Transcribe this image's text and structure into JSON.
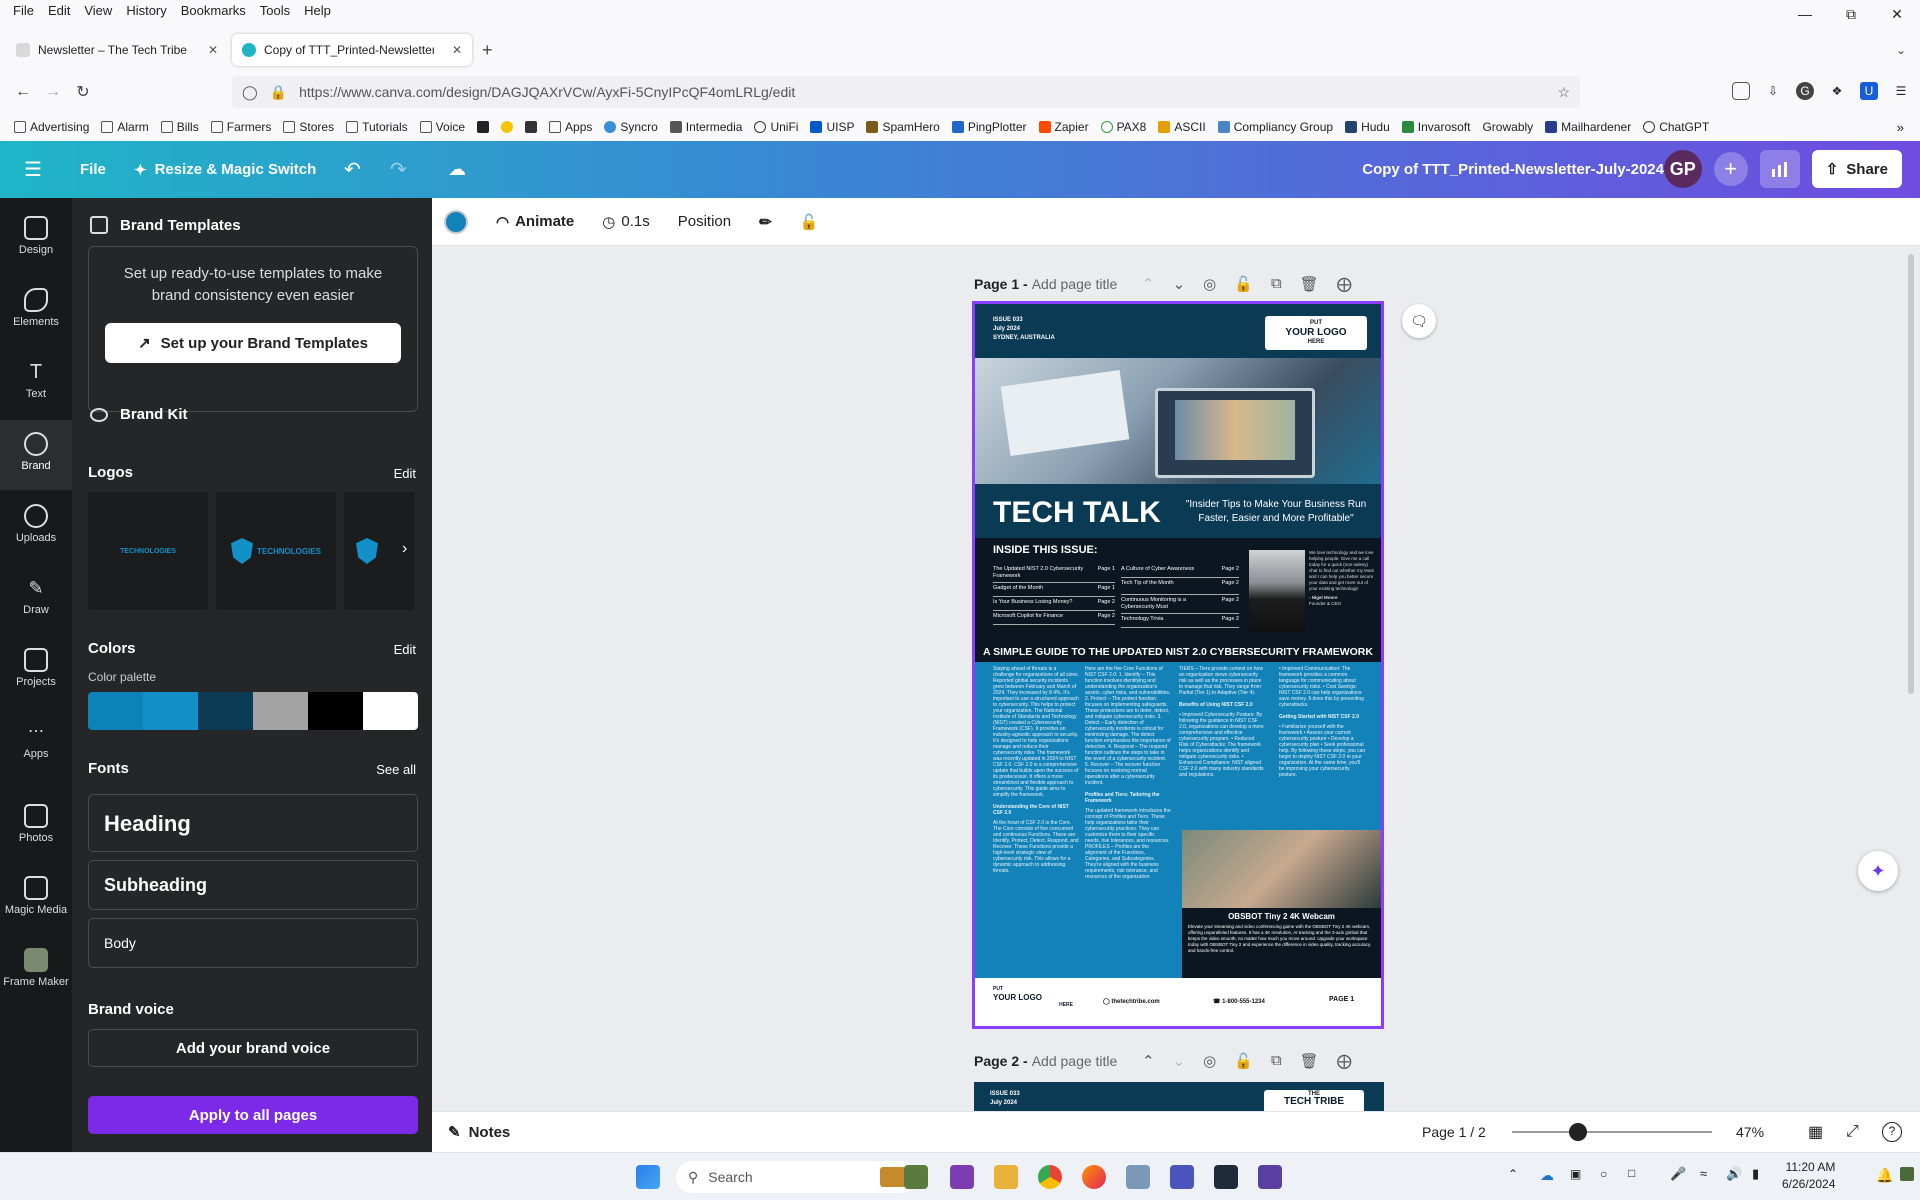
{
  "browser": {
    "menu": [
      "File",
      "Edit",
      "View",
      "History",
      "Bookmarks",
      "Tools",
      "Help"
    ],
    "tabs": [
      {
        "title": "Newsletter – The Tech Tribe",
        "active": false
      },
      {
        "title": "Copy of TTT_Printed-Newsletter-J",
        "active": true
      }
    ],
    "url": "https://www.canva.com/design/DAGJQAXrVCw/AyxFi-5CnyIPcQF4omLRLg/edit",
    "bookmarks": [
      "Advertising",
      "Alarm",
      "Bills",
      "Farmers",
      "Stores",
      "Tutorials",
      "Voice",
      "Apps",
      "Syncro",
      "Intermedia",
      "UniFi",
      "UISP",
      "SpamHero",
      "PingPlotter",
      "Zapier",
      "PAX8",
      "ASCII",
      "Compliancy Group",
      "Hudu",
      "Invarosoft",
      "Growably",
      "Mailhardener",
      "ChatGPT"
    ]
  },
  "canva": {
    "header": {
      "file_label": "File",
      "resize_label": "Resize & Magic Switch",
      "doc_title": "Copy of  TTT_Printed-Newsletter-July-2024",
      "avatar_initials": "GP",
      "share_label": "Share"
    },
    "rail": [
      {
        "label": "Design"
      },
      {
        "label": "Elements"
      },
      {
        "label": "Text"
      },
      {
        "label": "Brand"
      },
      {
        "label": "Uploads"
      },
      {
        "label": "Draw"
      },
      {
        "label": "Projects"
      },
      {
        "label": "Apps"
      },
      {
        "label": "Photos"
      },
      {
        "label": "Magic Media"
      },
      {
        "label": "Frame Maker"
      }
    ],
    "panel": {
      "brand_templates_title": "Brand Templates",
      "brand_templates_desc": "Set up ready-to-use templates to make brand consistency even easier",
      "brand_templates_button": "Set up your Brand Templates",
      "brand_kit_label": "Brand Kit",
      "logos_title": "Logos",
      "logos_edit": "Edit",
      "logo_texts": [
        "TECHNOLOGIES",
        "TECHNOLOGIES"
      ],
      "colors_title": "Colors",
      "colors_edit": "Edit",
      "palette_title": "Color palette",
      "palette": [
        "#0b83b8",
        "#1390c8",
        "#0b3a55",
        "#a3a3a3",
        "#000000",
        "#ffffff"
      ],
      "fonts_title": "Fonts",
      "fonts_see_all": "See all",
      "font_heading": "Heading",
      "font_subheading": "Subheading",
      "font_body": "Body",
      "voice_title": "Brand voice",
      "voice_button": "Add your brand voice",
      "apply_button": "Apply to all pages"
    },
    "toolbar": {
      "animate": "Animate",
      "duration": "0.1s",
      "position": "Position",
      "fill_color": "#1382b8"
    },
    "page1": {
      "label": "Page 1 -",
      "title_placeholder": "Add page title"
    },
    "page2": {
      "label": "Page 2 -",
      "title_placeholder": "Add page title"
    },
    "newsletter": {
      "issue": "ISSUE 033",
      "date": "July 2024",
      "location": "SYDNEY, AUSTRALIA",
      "logo_put": "PUT",
      "logo_your": "YOUR",
      "logo_logo": "LOGO",
      "logo_here": "HERE",
      "title": "TECH TALK",
      "tagline": "\"Insider Tips to Make Your Business Run Faster, Easier and More Profitable\"",
      "inside_title": "INSIDE THIS ISSUE:",
      "inside_left": [
        {
          "t": "The Updated NIST 2.0 Cybersecurity Framework",
          "p": "Page 1"
        },
        {
          "t": "Gadget of the Month",
          "p": "Page 1"
        },
        {
          "t": "Is Your Business Losing Money?",
          "p": "Page 2"
        },
        {
          "t": "Microsoft Copilot for Finance",
          "p": "Page 2"
        }
      ],
      "inside_right": [
        {
          "t": "A Culture of Cyber Awareness",
          "p": "Page 2"
        },
        {
          "t": "Tech Tip of the Month",
          "p": "Page 2"
        },
        {
          "t": "Continuous Monitoring is a Cybersecurity Must",
          "p": "Page 2"
        },
        {
          "t": "Technology Trivia",
          "p": "Page 2"
        }
      ],
      "bio": "We love technology and we love helping people. Give me a call today for a quick (non-salesy) chat to find out whether my team and I can help you better secure your data and get more out of your existing technology!",
      "bio_name": "- Nigel Moore",
      "bio_role": "Founder & CEO",
      "band": "A SIMPLE GUIDE TO THE UPDATED NIST 2.0 CYBERSECURITY FRAMEWORK",
      "col1": "Staying ahead of threats is a challenge for organizations of all sizes. Reported global security incidents grew between February and March of 2024. They increased by 8.4%. It's important to use a structured approach to cybersecurity. This helps to protect your organization. The National Institute of Standards and Technology (NIST) created a Cybersecurity Framework (CSF). It provides an industry-agnostic approach to security. It's designed to help organizations manage and reduce their cybersecurity risks. The framework was recently updated in 2024 to NIST CSF 2.0. CSF 2.0 is a comprehensive update that builds upon the success of its predecessor. It offers a more streamlined and flexible approach to cybersecurity. This guide aims to simplify the framework.",
      "col1_h": "Understanding the Core of NIST CSF 2.0",
      "col1b": "At the heart of CSF 2.0 is the Core. The Core consists of five concurrent and continuous Functions. These are: Identify, Protect, Detect, Respond, and Recover. These Functions provide a high-level strategic view of cybersecurity risk. This allows for a dynamic approach to addressing threats.",
      "col2": "Here are the five Core Functions of NIST CSF 2.0: 1. Identify – This function involves identifying and understanding the organization's assets, cyber risks, and vulnerabilities. 2. Protect – The protect function focuses on implementing safeguards. These protections are to deter, detect, and mitigate cybersecurity risks. 3. Detect – Early detection of cybersecurity incidents is critical for minimizing damage. The detect function emphasizes the importance of detection. 4. Respond – The respond function outlines the steps to take in the event of a cybersecurity incident. 5. Recover – The recover function focuses on restoring normal operations after a cybersecurity incident.",
      "col2_h": "Profiles and Tiers: Tailoring the Framework",
      "col2b": "The updated framework introduces the concept of Profiles and Tiers. These help organizations tailor their cybersecurity practices. They can customize them to their specific needs, risk tolerances, and resources. PROFILES – Profiles are the alignment of the Functions, Categories, and Subcategories. They're aligned with the business requirements, risk tolerance, and resources of the organization.",
      "col3": "TIERS – Tiers provide context on how an organization views cybersecurity risk as well as the processes in place to manage that risk. They range from Partial (Tier 1) to Adaptive (Tier 4).",
      "col3_h": "Benefits of Using NIST CSF 2.0",
      "col3b": "• Improved Cybersecurity Posture: By following the guidance in NIST CSF 2.0, organizations can develop a more comprehensive and effective cybersecurity program. • Reduced Risk of Cyberattacks: The framework helps organizations identify and mitigate cybersecurity risks. • Enhanced Compliance: NIST aligned CSF 2.0 with many industry standards and regulations.",
      "col4": "• Improved Communication: The framework provides a common language for communicating about cybersecurity risks. • Cost Savings: NIST CSF 2.0 can help organizations save money. It does this by preventing cyberattacks.",
      "col4_h": "Getting Started with NIST CSF 2.0",
      "col4b": "• Familiarize yourself with the framework • Assess your current cybersecurity posture • Develop a cybersecurity plan • Seek professional help. By following these steps, you can begin to deploy NIST CSF 2.0 in your organization. At the same time, you'll be improving your cybersecurity posture.",
      "gadget_title": "OBSBOT Tiny 2 4K Webcam",
      "gadget_text": "Elevate your streaming and video conferencing game with the OBSBOT Tiny 2 4K webcam, offering unparalleled features. It has a 4K resolution, AI tracking and the 3-axis gimbal that keeps the video smooth, no matter how much you move around. Upgrade your workspace today with OBSBOT Tiny 2 and experience the difference in video quality, tracking accuracy, and hands-free control.",
      "footer_web": "thetechtribe.com",
      "footer_phone": "1-800-555-1234",
      "footer_page": "PAGE 1"
    },
    "page2_preview": {
      "issue": "ISSUE 033",
      "date": "July 2024",
      "logo_the": "THE",
      "logo_name": "TECH TRIBE"
    },
    "bottom": {
      "notes": "Notes",
      "pages": "Page 1 / 2",
      "zoom": "47%",
      "zoom_level": 0.47
    }
  },
  "taskbar": {
    "search_placeholder": "Search",
    "time": "11:20 AM",
    "date": "6/26/2024"
  }
}
